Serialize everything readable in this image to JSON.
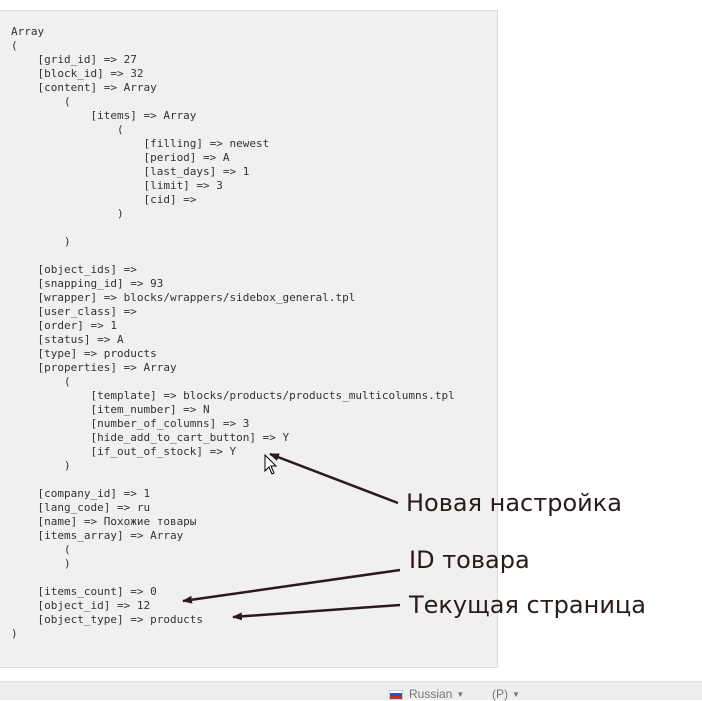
{
  "dump_lines": [
    "Array",
    "(",
    "    [grid_id] => 27",
    "    [block_id] => 32",
    "    [content] => Array",
    "        (",
    "            [items] => Array",
    "                (",
    "                    [filling] => newest",
    "                    [period] => A",
    "                    [last_days] => 1",
    "                    [limit] => 3",
    "                    [cid] =>",
    "                )",
    "",
    "        )",
    "",
    "    [object_ids] =>",
    "    [snapping_id] => 93",
    "    [wrapper] => blocks/wrappers/sidebox_general.tpl",
    "    [user_class] =>",
    "    [order] => 1",
    "    [status] => A",
    "    [type] => products",
    "    [properties] => Array",
    "        (",
    "            [template] => blocks/products/products_multicolumns.tpl",
    "            [item_number] => N",
    "            [number_of_columns] => 3",
    "            [hide_add_to_cart_button] => Y",
    "            [if_out_of_stock] => Y",
    "        )",
    "",
    "    [company_id] => 1",
    "    [lang_code] => ru",
    "    [name] => Похожие товары",
    "    [items_array] => Array",
    "        (",
    "        )",
    "",
    "    [items_count] => 0",
    "    [object_id] => 12",
    "    [object_type] => products",
    ")"
  ],
  "annotations": {
    "new_setting": "Новая настройка",
    "product_id": "ID товара",
    "current_page": "Текущая страница"
  },
  "footer": {
    "language": "Russian",
    "account": "(P)"
  },
  "colors": {
    "panel_background": "#f0f0f0",
    "code_text": "#333333",
    "arrow": "#2a1a1a",
    "footer_background": "#eeeeee"
  },
  "icons": [
    "russia-flag-icon",
    "caret-down-icon",
    "mouse-cursor-icon",
    "arrow-icon"
  ]
}
